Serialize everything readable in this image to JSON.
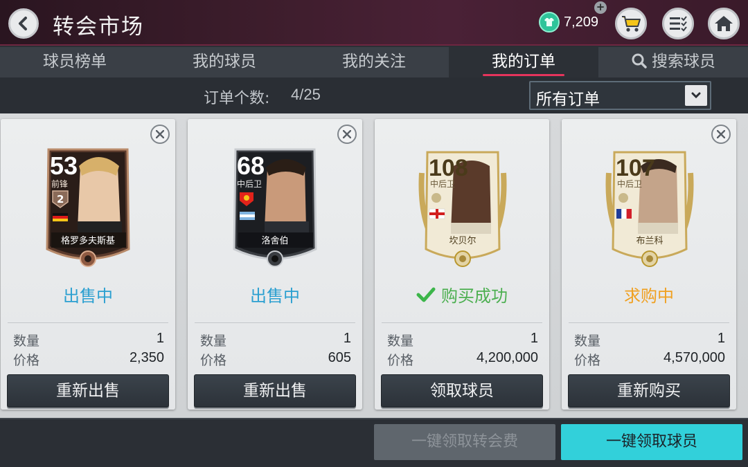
{
  "header": {
    "title": "转会市场",
    "coins": "7,209"
  },
  "tabs": [
    {
      "label": "球员榜单"
    },
    {
      "label": "我的球员"
    },
    {
      "label": "我的关注"
    },
    {
      "label": "我的订单"
    },
    {
      "label": "搜索球员"
    }
  ],
  "active_tab": 3,
  "subbar": {
    "count_label": "订单个数:",
    "count_value": "4/25",
    "filter": "所有订单"
  },
  "labels": {
    "quantity": "数量",
    "price": "价格"
  },
  "cards": [
    {
      "rating": "53",
      "position": "前锋",
      "name": "格罗多夫斯基",
      "status": "出售中",
      "status_color": "#2a9fd0",
      "quantity": "1",
      "price": "2,350",
      "action": "重新出售",
      "rank": "2"
    },
    {
      "rating": "68",
      "position": "中后卫",
      "name": "洛舍伯",
      "status": "出售中",
      "status_color": "#2a9fd0",
      "quantity": "1",
      "price": "605",
      "action": "重新出售"
    },
    {
      "rating": "108",
      "position": "中后卫",
      "name": "坎贝尔",
      "status": "购买成功",
      "status_color": "#4caf50",
      "quantity": "1",
      "price": "4,200,000",
      "action": "领取球员"
    },
    {
      "rating": "107",
      "position": "中后卫",
      "name": "布兰科",
      "status": "求购中",
      "status_color": "#f0a020",
      "quantity": "1",
      "price": "4,570,000",
      "action": "重新购买"
    }
  ],
  "bottom": {
    "claim_fee": "一键领取转会费",
    "claim_players": "一键领取球员"
  },
  "colors": {
    "accent": "#e6345c",
    "primary_button": "#32d0da"
  }
}
